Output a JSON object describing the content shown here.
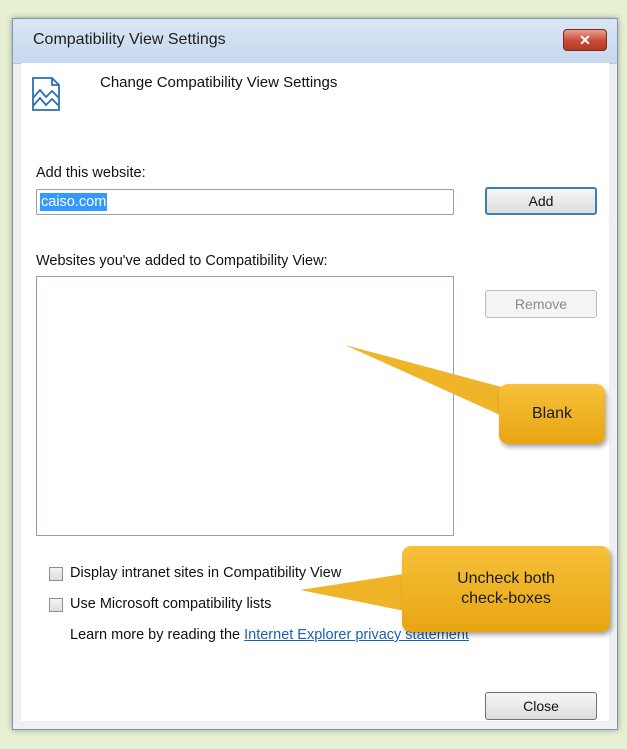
{
  "window": {
    "title": "Compatibility View Settings",
    "close_icon": "close-icon"
  },
  "header": {
    "icon": "compatibility-view-icon",
    "text": "Change Compatibility View Settings"
  },
  "add_section": {
    "label": "Add this website:",
    "input_value": "caiso.com",
    "add_button": "Add"
  },
  "list_section": {
    "label": "Websites you've added to Compatibility View:",
    "items": [],
    "remove_button": "Remove"
  },
  "options": {
    "intranet_label": "Display intranet sites in Compatibility View",
    "intranet_checked": false,
    "ms_lists_label": "Use Microsoft compatibility lists",
    "ms_lists_checked": false
  },
  "learn_more": {
    "prefix": "Learn more by reading the ",
    "link_text": "Internet Explorer privacy statement"
  },
  "footer": {
    "close_button": "Close"
  },
  "callouts": {
    "blank": "Blank",
    "uncheck_line1": "Uncheck both",
    "uncheck_line2": "check-boxes",
    "color": "#f0b429"
  }
}
